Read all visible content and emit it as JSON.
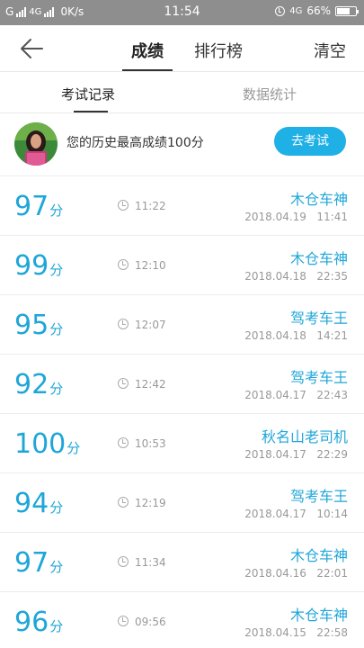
{
  "status_bar": {
    "carrier": "G",
    "network": "4G",
    "speed": "0K/s",
    "time": "11:54",
    "network_right": "4G",
    "battery": "66%"
  },
  "nav": {
    "tabs": [
      {
        "label": "成绩"
      },
      {
        "label": "排行榜"
      }
    ],
    "clear_label": "清空",
    "active_tab": "成绩"
  },
  "sub_tabs": [
    {
      "label": "考试记录"
    },
    {
      "label": "数据统计"
    }
  ],
  "best": {
    "text": "您的历史最高成绩100分",
    "button_label": "去考试"
  },
  "records": [
    {
      "score": "97",
      "unit": "分",
      "duration": "11:22",
      "name": "木仓车神",
      "date": "2018.04.19",
      "time": "11:41"
    },
    {
      "score": "99",
      "unit": "分",
      "duration": "12:10",
      "name": "木仓车神",
      "date": "2018.04.18",
      "time": "22:35"
    },
    {
      "score": "95",
      "unit": "分",
      "duration": "12:07",
      "name": "驾考车王",
      "date": "2018.04.18",
      "time": "14:21"
    },
    {
      "score": "92",
      "unit": "分",
      "duration": "12:42",
      "name": "驾考车王",
      "date": "2018.04.17",
      "time": "22:43"
    },
    {
      "score": "100",
      "unit": "分",
      "duration": "10:53",
      "name": "秋名山老司机",
      "date": "2018.04.17",
      "time": "22:29"
    },
    {
      "score": "94",
      "unit": "分",
      "duration": "12:19",
      "name": "驾考车王",
      "date": "2018.04.17",
      "time": "10:14"
    },
    {
      "score": "97",
      "unit": "分",
      "duration": "11:34",
      "name": "木仓车神",
      "date": "2018.04.16",
      "time": "22:01"
    },
    {
      "score": "96",
      "unit": "分",
      "duration": "09:56",
      "name": "木仓车神",
      "date": "2018.04.15",
      "time": "22:58"
    }
  ],
  "colors": {
    "accent": "#1fa6d9",
    "button": "#1fb0e6",
    "status_bar": "#8e8e8e"
  }
}
